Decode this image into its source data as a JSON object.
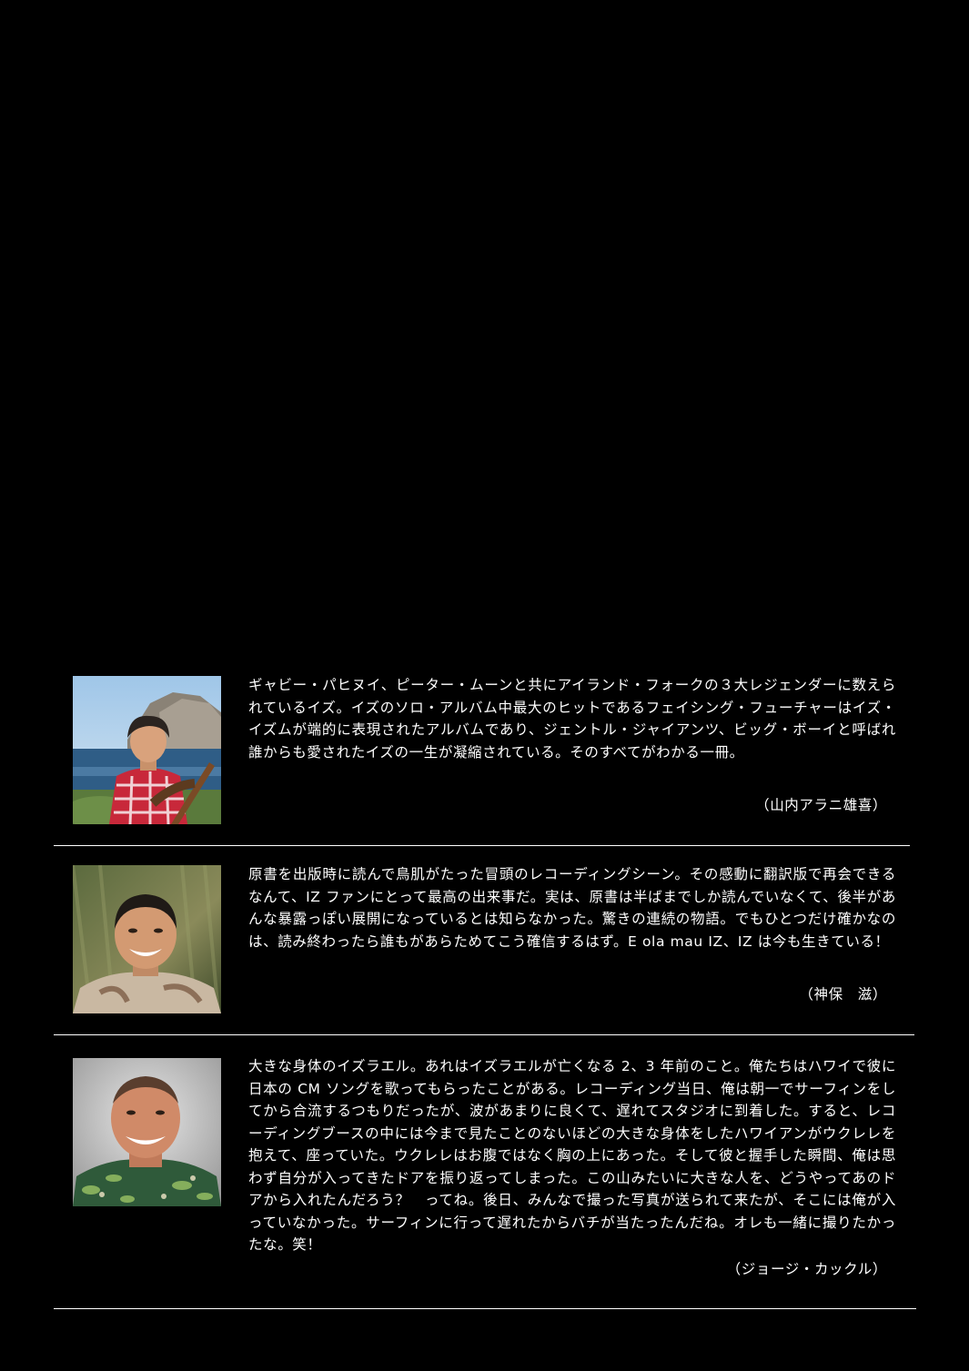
{
  "testimonials": [
    {
      "text": "ギャビー・パヒヌイ、ピーター・ムーンと共にアイランド・フォークの３大レジェンダーに数えられているイズ。イズのソロ・アルバム中最大のヒットであるフェイシング・フューチャーはイズ・イズムが端的に表現されたアルバムであり、ジェントル・ジャイアンツ、ビッグ・ボーイと呼ばれ誰からも愛されたイズの一生が凝縮されている。そのすべてがわかる一冊。",
      "author": "（山内アラニ雄喜）",
      "photo": "photo of a man with a ukulele by the ocean"
    },
    {
      "text": "原書を出版時に読んで鳥肌がたった冒頭のレコーディングシーン。その感動に翻訳版で再会できるなんて、IZ ファンにとって最高の出来事だ。実は、原書は半ばまでしか読んでいなくて、後半があんな暴露っぽい展開になっているとは知らなかった。驚きの連続の物語。でもひとつだけ確かなのは、読み終わったら誰もがあらためてこう確信するはず。E ola mau IZ、IZ は今も生きている！",
      "author": "（神保　滋）",
      "photo": "photo of a smiling man"
    },
    {
      "text": "大きな身体のイズラエル。あれはイズラエルが亡くなる 2、3 年前のこと。俺たちはハワイで彼に日本の CM ソングを歌ってもらったことがある。レコーディング当日、俺は朝一でサーフィンをしてから合流するつもりだったが、波があまりに良くて、遅れてスタジオに到着した。すると、レコーディングブースの中には今まで見たことのないほどの大きな身体をしたハワイアンがウクレレを抱えて、座っていた。ウクレレはお腹ではなく胸の上にあった。そして彼と握手した瞬間、俺は思わず自分が入ってきたドアを振り返ってしまった。この山みたいに大きな人を、どうやってあのドアから入れたんだろう？　ってね。後日、みんなで撮った写真が送られて来たが、そこには俺が入っていなかった。サーフィンに行って遅れたからバチが当たったんだね。オレも一緒に撮りたかったな。笑！",
      "author": "（ジョージ・カックル）",
      "photo": "photo of a man in a Hawaiian shirt"
    }
  ]
}
